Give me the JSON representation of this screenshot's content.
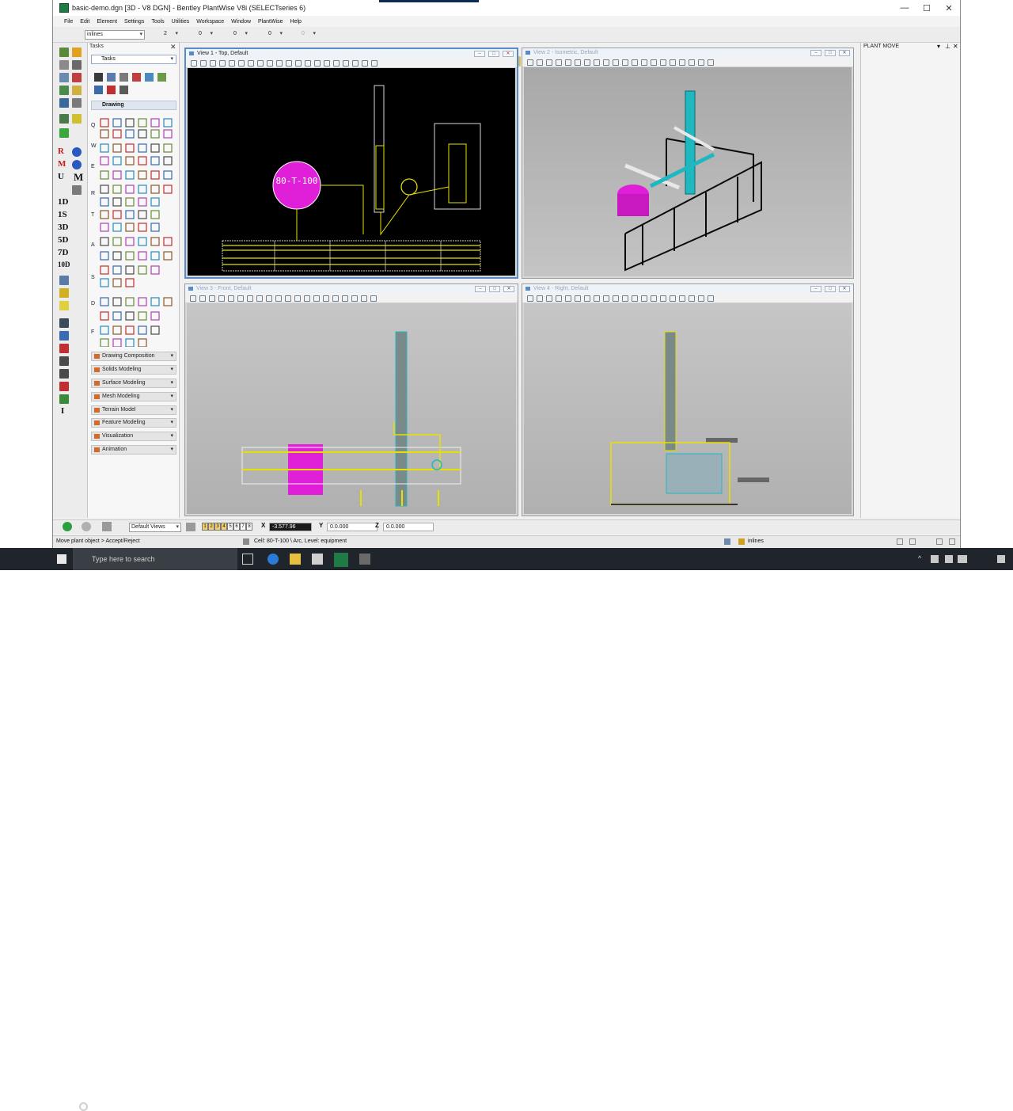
{
  "window": {
    "title": "basic-demo.dgn [3D - V8 DGN] - Bentley PlantWise V8i (SELECTseries 6)",
    "minimize": "—",
    "maximize": "☐",
    "close": "✕"
  },
  "menu": [
    "File",
    "Edit",
    "Element",
    "Settings",
    "Tools",
    "Utilities",
    "Workspace",
    "Window",
    "PlantWise",
    "Help"
  ],
  "toolbar": {
    "level": "inlines",
    "color": "2",
    "style": "0",
    "weight": "0",
    "transparency": "0",
    "priority": "0"
  },
  "tasks": {
    "header": "Tasks",
    "selected": "Tasks",
    "drawing_label": "Drawing",
    "section_letters": [
      "Q",
      "W",
      "E",
      "R",
      "T",
      "A",
      "S",
      "D",
      "F"
    ],
    "accordion": [
      "Drawing Composition",
      "Solids Modeling",
      "Surface Modeling",
      "Mesh Modeling",
      "Terrain Model",
      "Feature Modeling",
      "Visualization",
      "Animation"
    ]
  },
  "left_tools": {
    "labels": [
      "R",
      "M",
      "U",
      "M",
      "1D",
      "1S",
      "3D",
      "5D",
      "7D",
      "10D",
      "I"
    ]
  },
  "views": [
    {
      "title": "View 1 - Top, Default",
      "tank_label": "80-T-100"
    },
    {
      "title": "View 2 - Isometric, Default"
    },
    {
      "title": "View 3 - Front, Default"
    },
    {
      "title": "View 4 - Right, Default"
    }
  ],
  "plant_move": {
    "title": "PLANT MOVE"
  },
  "bottom": {
    "views_combo": "Default Views",
    "view_numbers": [
      "1",
      "2",
      "3",
      "4",
      "5",
      "6",
      "7",
      "8"
    ],
    "x_label": "X",
    "x_value": "-3.577.96",
    "y_label": "Y",
    "y_value": "0.0.000",
    "z_label": "Z",
    "z_value": "0.0.000"
  },
  "status": {
    "prompt": "Move plant object > Accept/Reject",
    "message": "Cell: 80-T-100 \\ Arc, Level: equipment",
    "level": "inlines"
  },
  "taskbar": {
    "search_placeholder": "Type here to search"
  },
  "colors": {
    "canvas_top": "#000000",
    "canvas_gray": "#b4b4b4",
    "pipe_yellow": "#e8e000",
    "vessel_cyan": "#20b8c0",
    "tank_magenta": "#e020d8",
    "structure_black": "#0a0a0a"
  }
}
